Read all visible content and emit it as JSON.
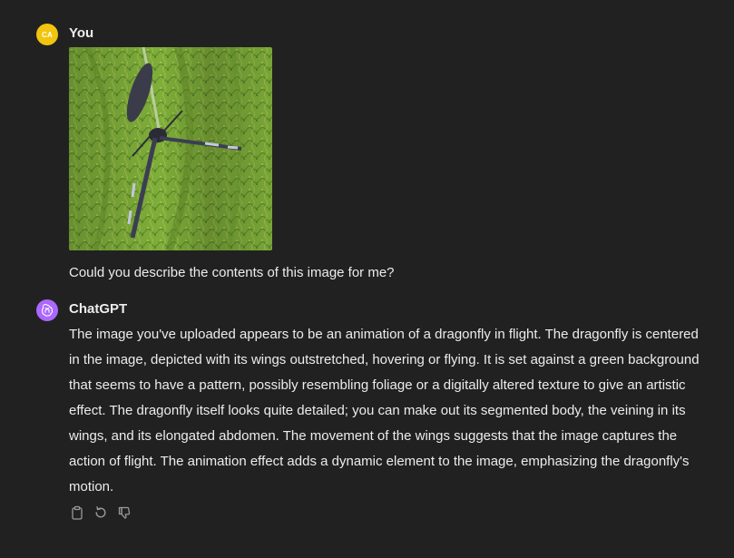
{
  "user": {
    "avatar_initials": "CA",
    "name": "You",
    "message": "Could you describe the contents of this image for me?"
  },
  "assistant": {
    "name": "ChatGPT",
    "message": "The image you've uploaded appears to be an animation of a dragonfly in flight. The dragonfly is centered in the image, depicted with its wings outstretched, hovering or flying. It is set against a green background that seems to have a pattern, possibly resembling foliage or a digitally altered texture to give an artistic effect. The dragonfly itself looks quite detailed; you can make out its segmented body, the veining in its wings, and its elongated abdomen. The movement of the wings suggests that the image captures the action of flight. The animation effect adds a dynamic element to the image, emphasizing the dragonfly's motion."
  },
  "actions": {
    "icons": [
      "clipboard-icon",
      "regenerate-icon",
      "thumbs-down-icon"
    ]
  },
  "colors": {
    "background": "#212121",
    "text": "#ececec",
    "user_avatar": "#f1c40f",
    "assistant_avatar": "#ab68ff",
    "image_green": "#7fae3a"
  }
}
